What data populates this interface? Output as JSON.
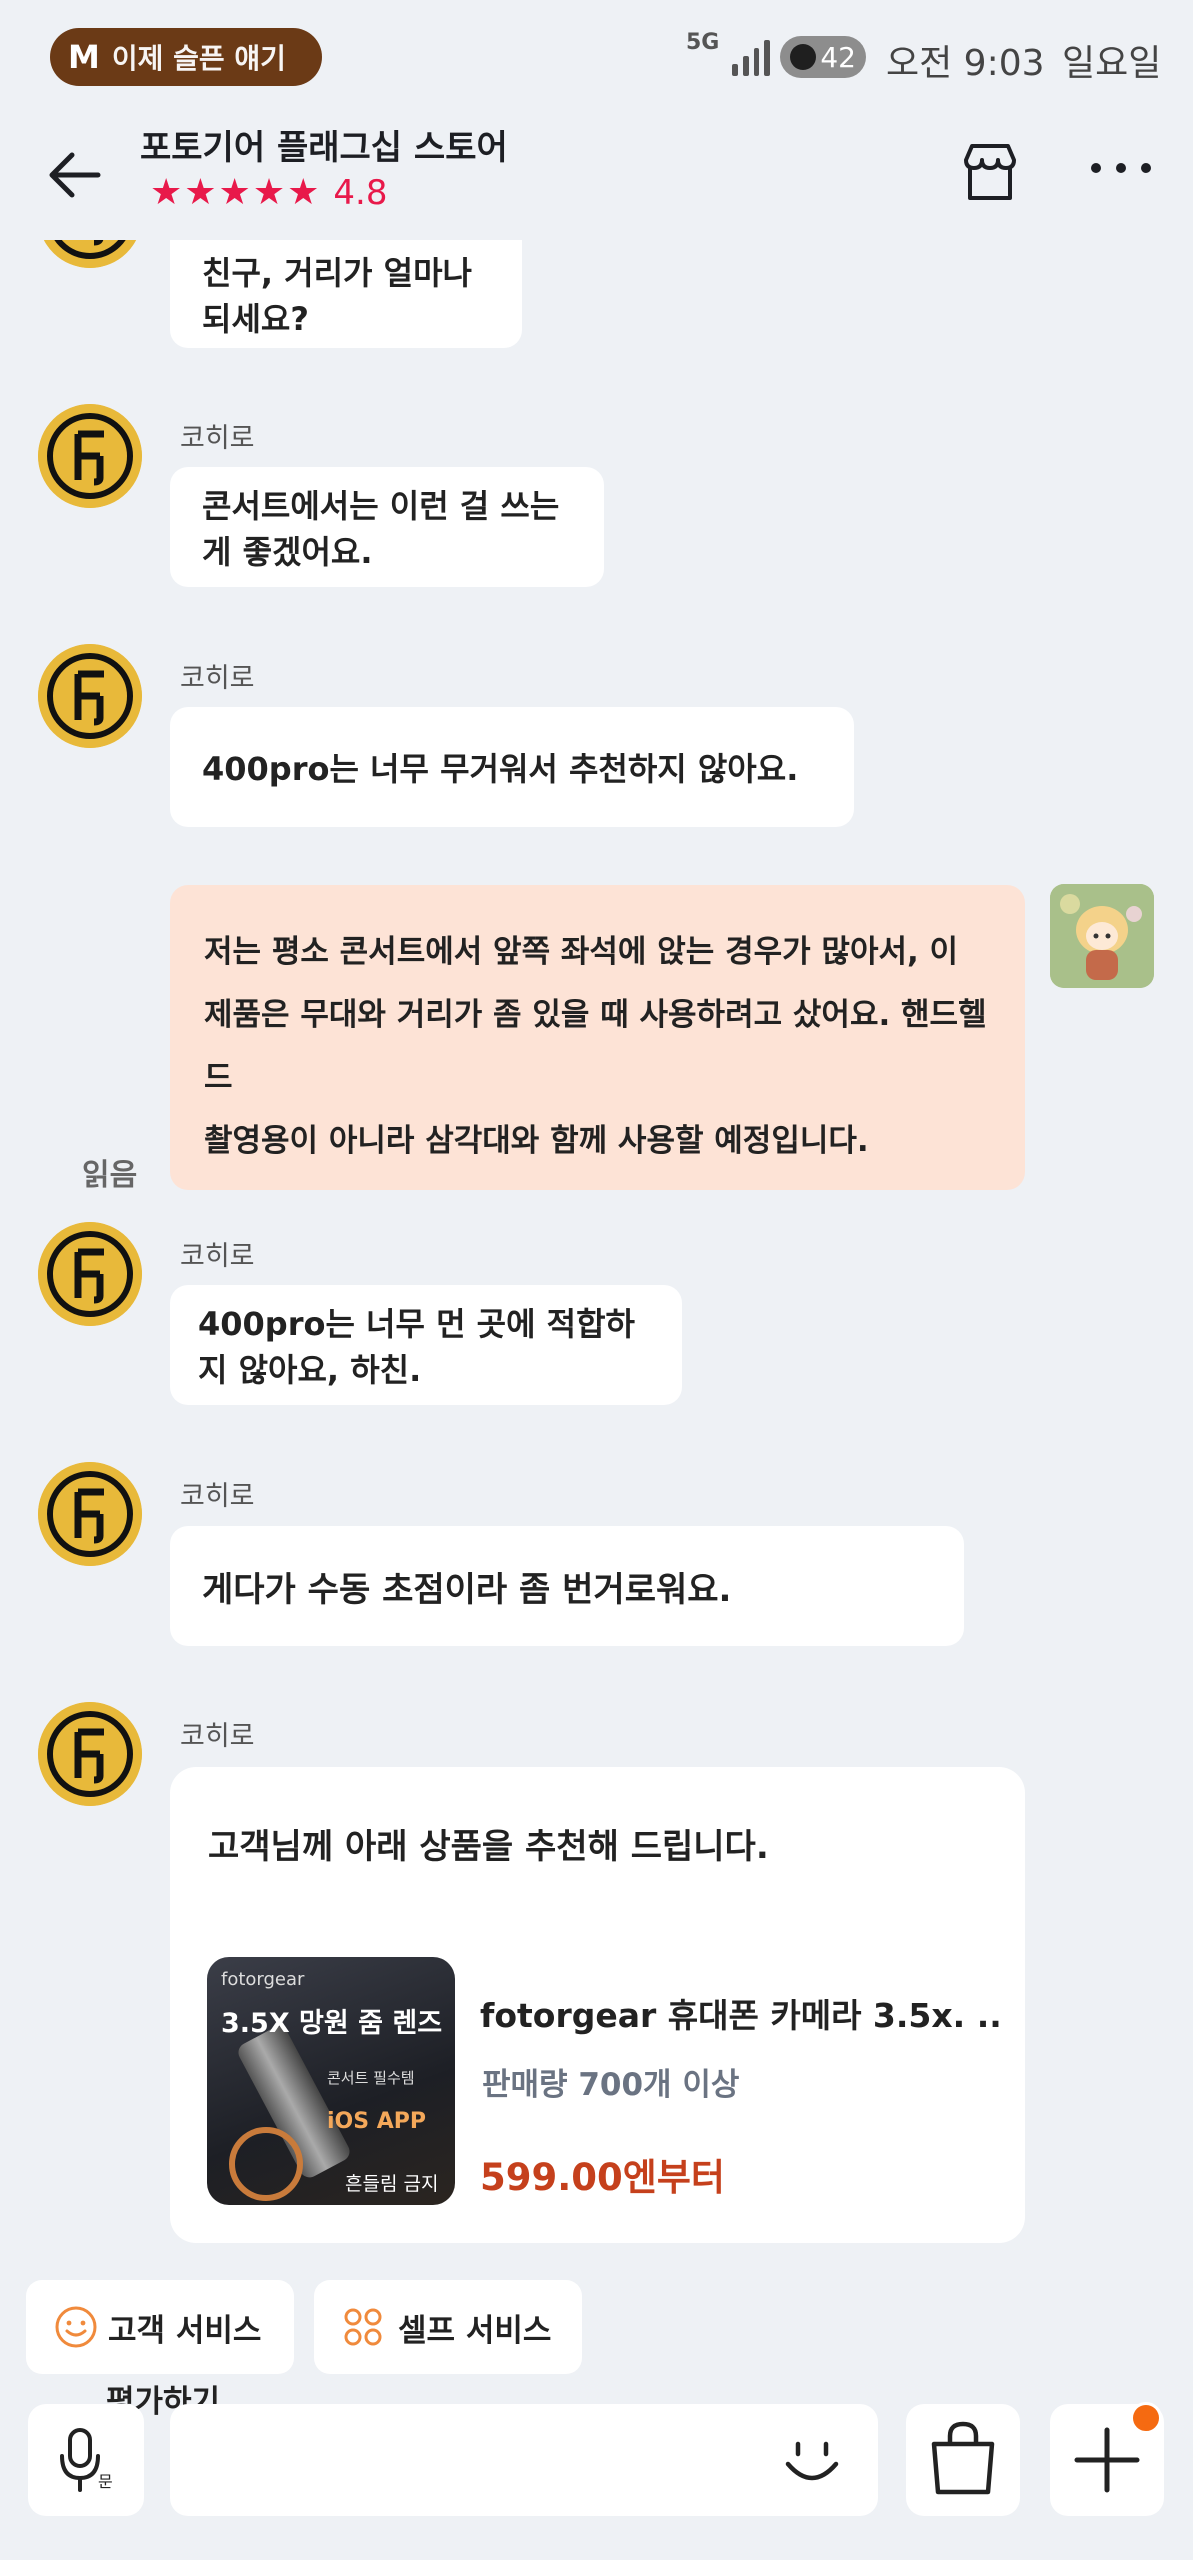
{
  "status_bar": {
    "music_app_logo": "M",
    "music_title": "이제 슬픈 얘기",
    "network": "5G",
    "battery": "42",
    "time": "오전 9:03",
    "day": "일요일"
  },
  "header": {
    "store_name": "포토기어 플래그십 스토어",
    "stars": "★★★★★",
    "rating": "4.8"
  },
  "messages": [
    {
      "sender": "",
      "text": "친구, 거리가 얼마나 되세요?"
    },
    {
      "sender": "코히로",
      "text": "콘서트에서는 이런 걸 쓰는 게 좋겠어요."
    },
    {
      "sender": "코히로",
      "text": "400pro는 너무 무거워서 추천하지 않아요."
    },
    {
      "sender": "me",
      "read_label": "읽음",
      "lines": [
        "저는 평소 콘서트에서 앞쪽 좌석에 앉는 경우가 많아서, 이",
        "제품은 무대와 거리가 좀 있을 때 사용하려고 샀어요. 핸드헬드",
        "촬영용이 아니라 삼각대와 함께 사용할 예정입니다."
      ]
    },
    {
      "sender": "코히로",
      "text": "400pro는 너무 먼 곳에 적합하지 않아요, 하친."
    },
    {
      "sender": "코히로",
      "text": "게다가 수동 초점이라 좀 번거로워요."
    },
    {
      "sender": "코히로",
      "text": "고객님께 아래 상품을 추천해 드립니다."
    }
  ],
  "product": {
    "thumb_brand": "fotorgear",
    "thumb_headline": "3.5X 망원 줌 렌즈",
    "thumb_tag": "콘서트 필수템",
    "thumb_ios": "iOS APP",
    "thumb_warning": "흔들림 금지",
    "name": "fotorgear 휴대폰 카메라 3.5x. ..",
    "sales": "판매량 700개 이상",
    "price": "599.00엔부터"
  },
  "quick_actions": {
    "customer_service": "고객 서비스",
    "self_service": "셀프 서비스",
    "rate": "평가하기"
  },
  "input_bar": {
    "mic_label": "문"
  },
  "colors": {
    "background": "#eef1f5",
    "my_bubble": "#fde3d6",
    "rating_red": "#e8194a",
    "price_red": "#c5401c",
    "accent_orange": "#f56a11"
  }
}
